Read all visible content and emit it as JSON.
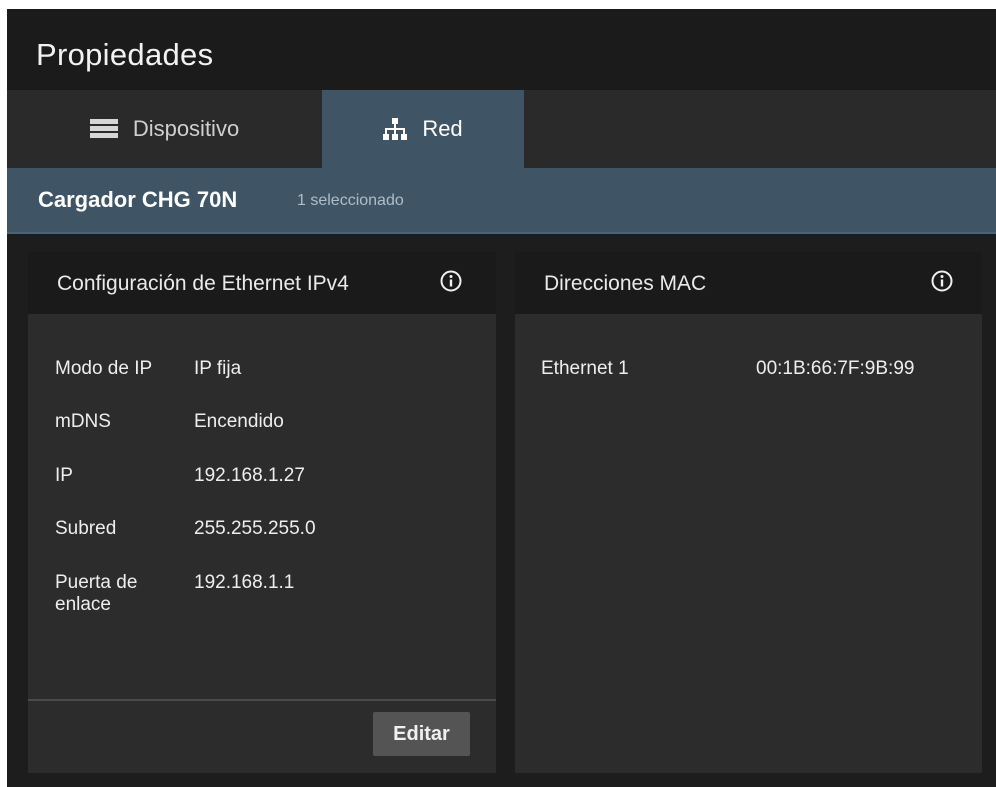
{
  "window": {
    "title": "Propiedades"
  },
  "tabs": [
    {
      "label": "Dispositivo",
      "icon": "list-icon",
      "active": false
    },
    {
      "label": "Red",
      "icon": "network-icon",
      "active": true
    }
  ],
  "selection": {
    "device_name": "Cargador CHG 70N",
    "selected_count": "1 seleccionado"
  },
  "ethernet_panel": {
    "title": "Configuración de Ethernet IPv4",
    "info_icon": "info-icon",
    "fields": [
      {
        "label": "Modo de IP",
        "value": "IP fija"
      },
      {
        "label": "mDNS",
        "value": "Encendido"
      },
      {
        "label": "IP",
        "value": "192.168.1.27"
      },
      {
        "label": "Subred",
        "value": "255.255.255.0"
      },
      {
        "label": "Puerta de enlace",
        "value": "192.168.1.1"
      }
    ],
    "edit_label": "Editar"
  },
  "mac_panel": {
    "title": "Direcciones MAC",
    "info_icon": "info-icon",
    "entries": [
      {
        "label": "Ethernet 1",
        "value": "00:1B:66:7F:9B:99"
      }
    ]
  },
  "colors": {
    "background": "#1d1d1d",
    "title_bar": "#1b1b1b",
    "tab_bar": "#2a2a2a",
    "accent": "#3f5566",
    "panel": "#2c2c2c",
    "panel_header": "#1a1a1a",
    "button": "#545454"
  }
}
